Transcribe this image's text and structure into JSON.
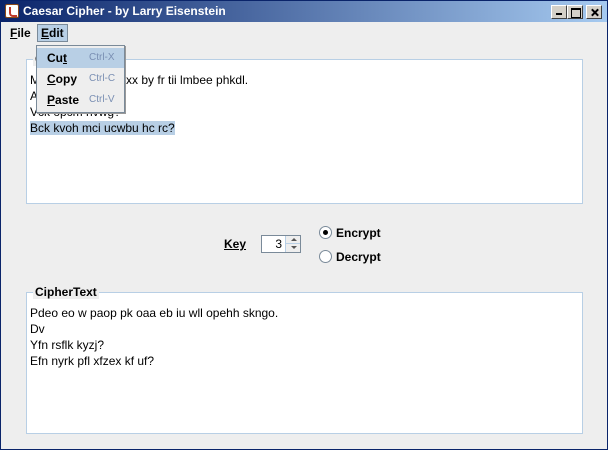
{
  "window": {
    "title": "Caesar Cipher - by Larry Eisenstein"
  },
  "menubar": {
    "file_label": "File",
    "file_mnemonic": "F",
    "file_rest": "ile",
    "edit_label": "Edit",
    "edit_mnemonic": "E",
    "edit_rest": "dit"
  },
  "edit_menu": {
    "items": [
      {
        "label": "Cut",
        "pre": "Cu",
        "mnemonic": "t",
        "post": "",
        "shortcut": "Ctrl-X"
      },
      {
        "label": "Copy",
        "pre": "",
        "mnemonic": "C",
        "post": "opy",
        "shortcut": "Ctrl-C"
      },
      {
        "label": "Paste",
        "pre": "",
        "mnemonic": "P",
        "post": "aste",
        "shortcut": "Ctrl-V"
      }
    ]
  },
  "plaintext": {
    "title_visible": "C",
    "lines": [
      {
        "text": "M                      h lxx by fr tii lmbee phkdl.",
        "selected": false
      },
      {
        "text": "A",
        "selected": false
      },
      {
        "text": "Vck opcm hvwg?",
        "selected": false
      },
      {
        "text": "Bck kvoh mci ucwbu hc rc?",
        "selected": true
      }
    ]
  },
  "controls": {
    "key_label": "Key",
    "key_value": "3",
    "encrypt_label": "Encrypt",
    "decrypt_label": "Decrypt",
    "selected_mode": "Encrypt"
  },
  "ciphertext": {
    "title": "CipherText",
    "lines": [
      "Pdeo eo w paop pk oaa eb iu wll opehh skngo.",
      "Dv",
      "Yfn rsflk kyzj?",
      "Efn nyrk pfl xfzex kf uf?"
    ]
  }
}
